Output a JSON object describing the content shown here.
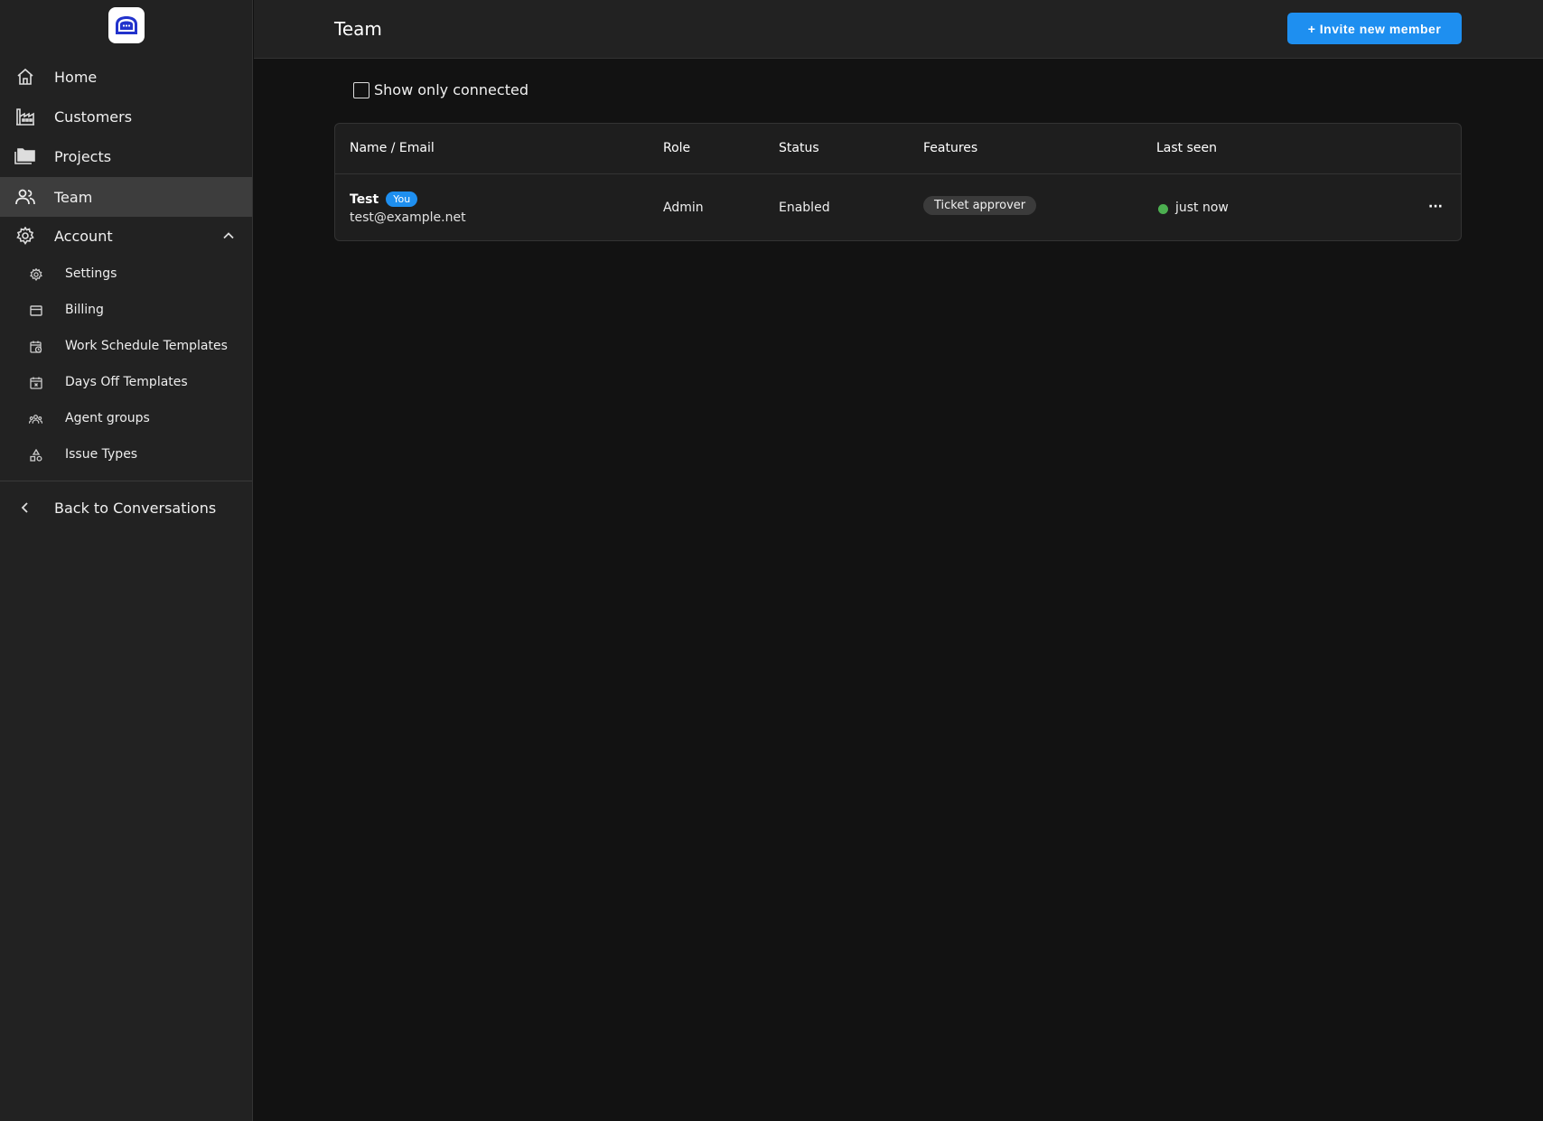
{
  "sidebar": {
    "logo_icon": "chat-bubble-logo-icon",
    "items": [
      {
        "label": "Home",
        "icon": "home-icon"
      },
      {
        "label": "Customers",
        "icon": "factory-icon"
      },
      {
        "label": "Projects",
        "icon": "folders-icon"
      },
      {
        "label": "Team",
        "icon": "people-icon",
        "active": true
      },
      {
        "label": "Account",
        "icon": "gear-icon",
        "expanded": true
      }
    ],
    "account_sub": [
      {
        "label": "Settings",
        "icon": "gear-icon"
      },
      {
        "label": "Billing",
        "icon": "credit-card-icon"
      },
      {
        "label": "Work Schedule Templates",
        "icon": "calendar-clock-icon"
      },
      {
        "label": "Days Off Templates",
        "icon": "calendar-x-icon"
      },
      {
        "label": "Agent groups",
        "icon": "group-icon"
      },
      {
        "label": "Issue Types",
        "icon": "shapes-icon"
      }
    ],
    "back_label": "Back to Conversations"
  },
  "header": {
    "title": "Team",
    "invite_label": "+ Invite new member"
  },
  "filter": {
    "label": "Show only connected",
    "checked": false
  },
  "table": {
    "columns": [
      "Name / Email",
      "Role",
      "Status",
      "Features",
      "Last seen"
    ],
    "rows": [
      {
        "name": "Test",
        "badge": "You",
        "email": "test@example.net",
        "role": "Admin",
        "status": "Enabled",
        "feature": "Ticket approver",
        "last_seen": "just now",
        "more": "···"
      }
    ]
  },
  "colors": {
    "accent": "#1e8ff0",
    "online": "#4caf50",
    "sidebar_bg": "#222222",
    "main_bg": "#121212"
  }
}
